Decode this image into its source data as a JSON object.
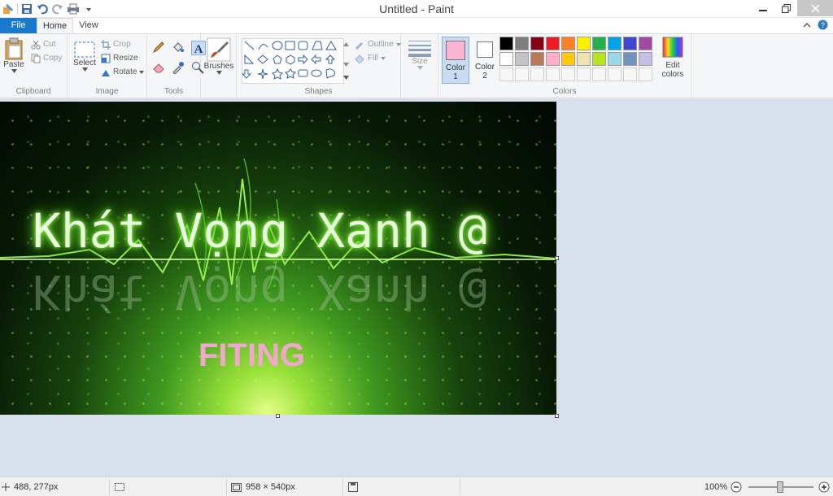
{
  "window": {
    "title": "Untitled - Paint"
  },
  "qat": {
    "icons": [
      "paint-app-icon",
      "save-icon",
      "undo-icon",
      "redo-icon",
      "print-icon",
      "customize-qat-icon"
    ]
  },
  "tabs": {
    "file": "File",
    "home": "Home",
    "view": "View"
  },
  "ribbon": {
    "clipboard": {
      "label": "Clipboard",
      "paste": "Paste",
      "cut": "Cut",
      "copy": "Copy"
    },
    "image": {
      "label": "Image",
      "select": "Select",
      "crop": "Crop",
      "resize": "Resize",
      "rotate": "Rotate"
    },
    "tools": {
      "label": "Tools"
    },
    "brushes": {
      "label": "Brushes"
    },
    "shapes": {
      "label": "Shapes",
      "outline": "Outline",
      "fill": "Fill"
    },
    "size": {
      "label": "Size"
    },
    "colors": {
      "label": "Colors",
      "color1": "Color",
      "color1_num": "1",
      "color2": "Color",
      "color2_num": "2",
      "edit": "Edit",
      "edit2": "colors",
      "color1_value": "#f9b4cf",
      "color2_value": "#ffffff",
      "palette_row1": [
        "#000000",
        "#7f7f7f",
        "#880015",
        "#ed1c24",
        "#ff7f27",
        "#fff200",
        "#22b14c",
        "#00a2e8",
        "#3f48cc",
        "#a349a4"
      ],
      "palette_row2": [
        "#ffffff",
        "#c3c3c3",
        "#b97a57",
        "#ffaec9",
        "#ffc90e",
        "#efe4b0",
        "#b5e61d",
        "#99d9ea",
        "#7092be",
        "#c8bfe7"
      ]
    }
  },
  "canvas": {
    "headline": "Khát Vọng Xanh @",
    "tagline": "FITING",
    "headline_color": "#e9ffdc",
    "tagline_color": "#f2a7cf"
  },
  "status": {
    "cursor_pos": "488, 277px",
    "image_size": "958 × 540px",
    "zoom": "100%"
  }
}
